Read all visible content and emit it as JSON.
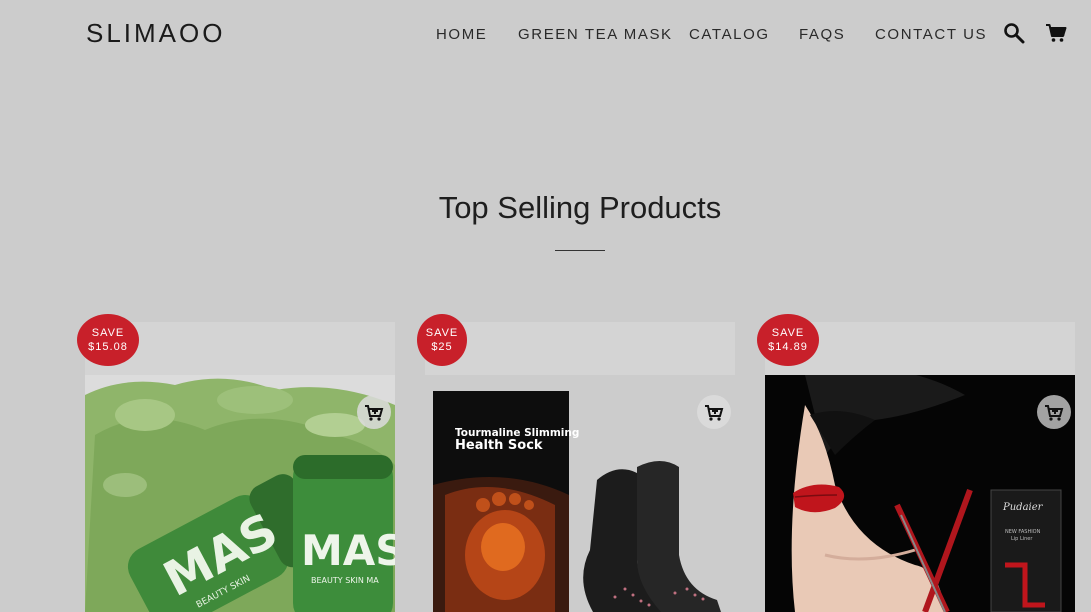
{
  "header": {
    "logo": "SLIMAOO",
    "nav": [
      "HOME",
      "GREEN TEA MASK",
      "CATALOG",
      "FAQS",
      "CONTACT US"
    ],
    "icons": [
      "search-icon",
      "cart-icon"
    ]
  },
  "section": {
    "title": "Top Selling Products"
  },
  "products": [
    {
      "badge_label": "SAVE",
      "badge_amount": "$15.08",
      "image_text": [
        "MAS",
        "BEAUTY SKIN",
        "MAS",
        "BEAUTY SKIN MA"
      ]
    },
    {
      "badge_label": "SAVE",
      "badge_amount": "$25",
      "image_text": [
        "Tourmaline Slimming",
        "Health Sock"
      ]
    },
    {
      "badge_label": "SAVE",
      "badge_amount": "$14.89",
      "image_text": [
        "Pudaier",
        "NEW FASHION",
        "Lip Liner"
      ]
    }
  ],
  "colors": {
    "background": "#cccccc",
    "badge": "#c8202a",
    "text": "#1e1e1e"
  }
}
